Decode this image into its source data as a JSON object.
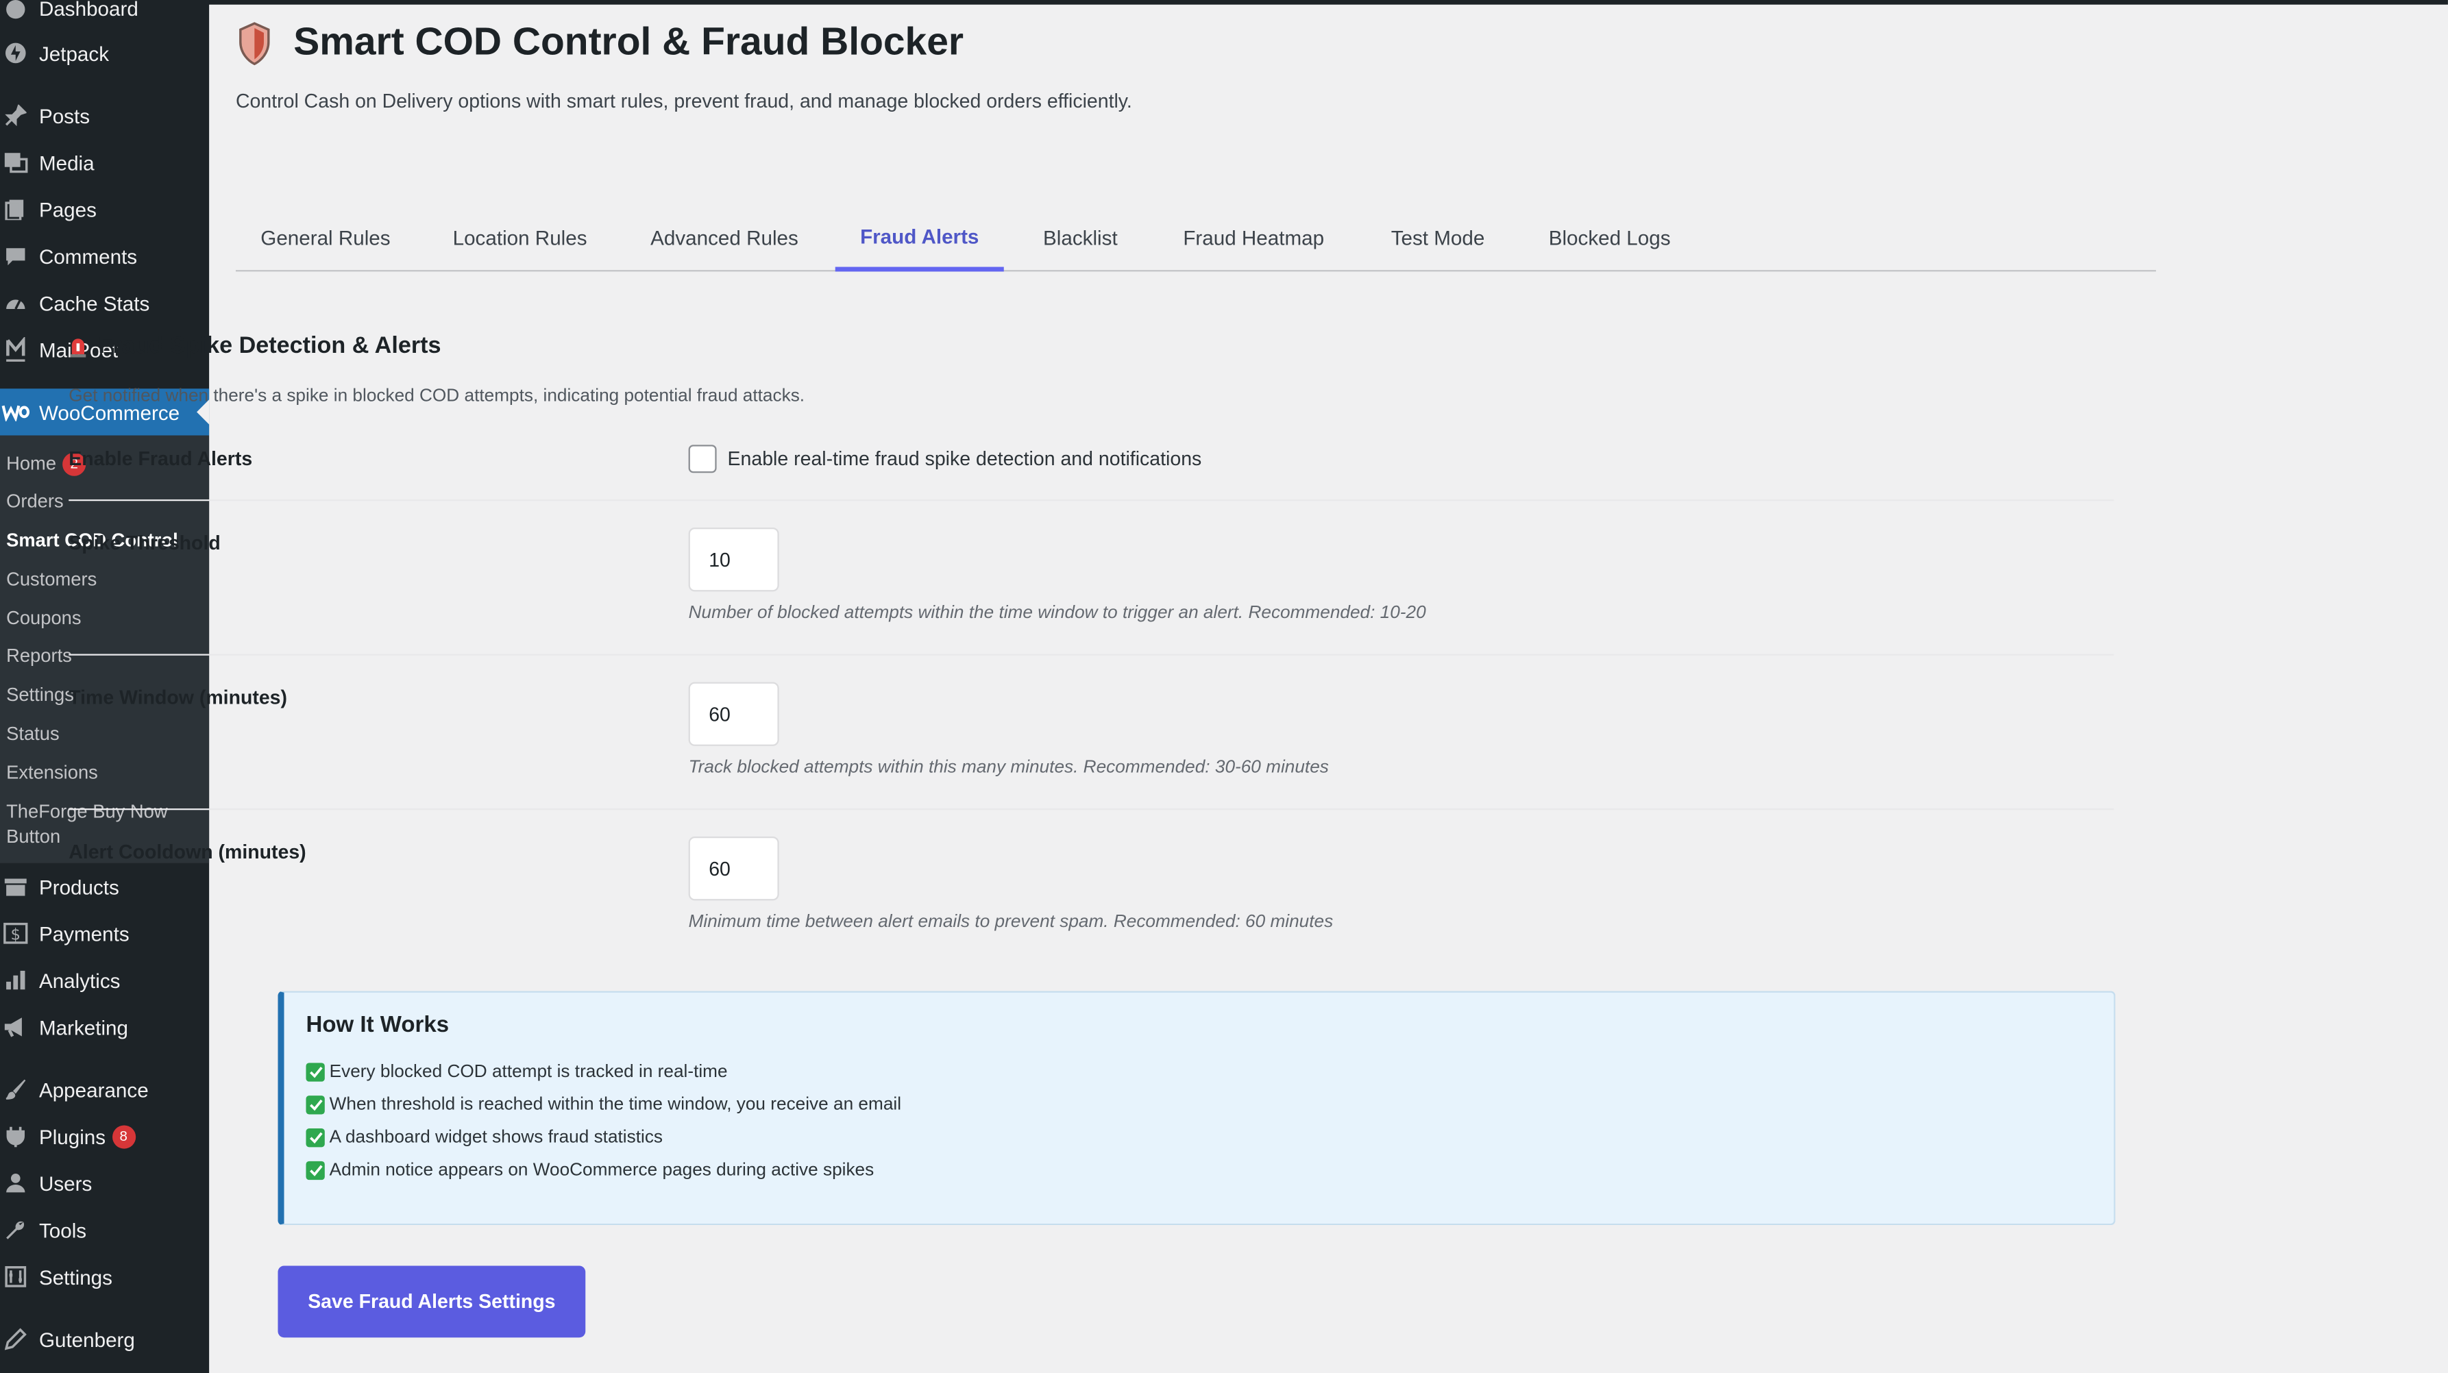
{
  "sidebar": {
    "top_items": [
      {
        "label": "Dashboard",
        "icon": "dashboard-icon"
      },
      {
        "label": "Jetpack",
        "icon": "jetpack-icon"
      },
      {
        "label": "Posts",
        "icon": "pin-icon"
      },
      {
        "label": "Media",
        "icon": "media-icon"
      },
      {
        "label": "Pages",
        "icon": "pages-icon"
      },
      {
        "label": "Comments",
        "icon": "comment-icon"
      },
      {
        "label": "Cache Stats",
        "icon": "gauge-icon"
      },
      {
        "label": "MailPoet",
        "icon": "mailpoet-icon"
      },
      {
        "label": "WooCommerce",
        "icon": "woo-icon"
      }
    ],
    "woo_submenu": [
      {
        "label": "Home",
        "badge": "2"
      },
      {
        "label": "Orders"
      },
      {
        "label": "Smart COD Control"
      },
      {
        "label": "Customers"
      },
      {
        "label": "Coupons"
      },
      {
        "label": "Reports"
      },
      {
        "label": "Settings"
      },
      {
        "label": "Status"
      },
      {
        "label": "Extensions"
      },
      {
        "label": "TheForge Buy Now Button"
      }
    ],
    "bottom_items": [
      {
        "label": "Products",
        "icon": "archive-icon"
      },
      {
        "label": "Payments",
        "icon": "dollar-icon"
      },
      {
        "label": "Analytics",
        "icon": "bar-chart-icon"
      },
      {
        "label": "Marketing",
        "icon": "megaphone-icon"
      },
      {
        "label": "Appearance",
        "icon": "brush-icon"
      },
      {
        "label": "Plugins",
        "icon": "plug-icon",
        "badge": "8"
      },
      {
        "label": "Users",
        "icon": "user-icon"
      },
      {
        "label": "Tools",
        "icon": "wrench-icon"
      },
      {
        "label": "Settings",
        "icon": "settings-icon"
      },
      {
        "label": "Gutenberg",
        "icon": "pencil-icon"
      }
    ]
  },
  "header": {
    "title": "Smart COD Control & Fraud Blocker",
    "description": "Control Cash on Delivery options with smart rules, prevent fraud, and manage blocked orders efficiently."
  },
  "tabs": [
    {
      "label": "General Rules"
    },
    {
      "label": "Location Rules"
    },
    {
      "label": "Advanced Rules"
    },
    {
      "label": "Fraud Alerts",
      "active": true
    },
    {
      "label": "Blacklist"
    },
    {
      "label": "Fraud Heatmap"
    },
    {
      "label": "Test Mode"
    },
    {
      "label": "Blocked Logs"
    }
  ],
  "section": {
    "title": "Fraud Spike Detection & Alerts",
    "description": "Get notified when there's a spike in blocked COD attempts, indicating potential fraud attacks."
  },
  "fields": {
    "enable": {
      "label": "Enable Fraud Alerts",
      "checkbox_label": "Enable real-time fraud spike detection and notifications",
      "checked": false
    },
    "threshold": {
      "label": "Spike Threshold",
      "value": "10",
      "help": "Number of blocked attempts within the time window to trigger an alert. Recommended: 10-20"
    },
    "window": {
      "label": "Time Window (minutes)",
      "value": "60",
      "help": "Track blocked attempts within this many minutes. Recommended: 30-60 minutes"
    },
    "cooldown": {
      "label": "Alert Cooldown (minutes)",
      "value": "60",
      "help": "Minimum time between alert emails to prevent spam. Recommended: 60 minutes"
    }
  },
  "info_box": {
    "title": "How It Works",
    "lines": [
      "Every blocked COD attempt is tracked in real-time",
      "When threshold is reached within the time window, you receive an email",
      "A dashboard widget shows fraud statistics",
      "Admin notice appears on WooCommerce pages during active spikes"
    ]
  },
  "save_button": "Save Fraud Alerts Settings",
  "colors": {
    "sidebar_bg": "#1d2327",
    "active_menu": "#2271b1",
    "accent": "#5b5ce0",
    "info_bg": "#e7f3fc"
  }
}
